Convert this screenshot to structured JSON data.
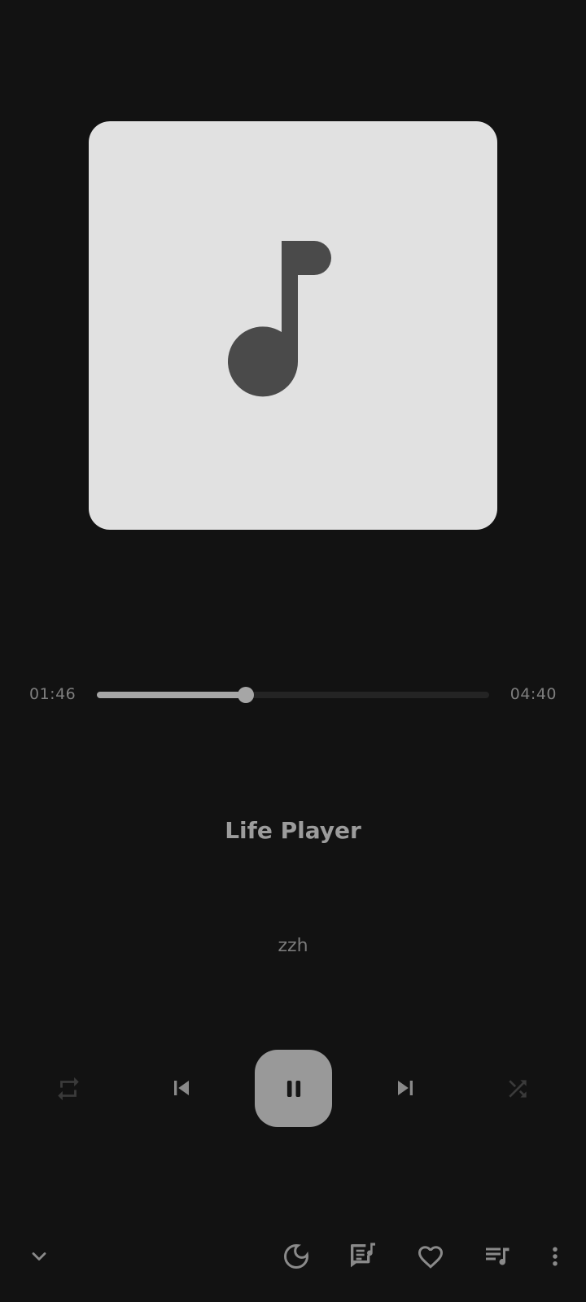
{
  "player": {
    "current_time": "01:46",
    "total_time": "04:40",
    "progress": 0.379,
    "title": "Life Player",
    "artist": "zzh"
  },
  "icons": {
    "album_art": "music-note-icon",
    "repeat": "repeat-icon",
    "previous": "skip-previous-icon",
    "play_pause": "pause-icon",
    "next": "skip-next-icon",
    "shuffle": "shuffle-icon",
    "collapse": "chevron-down-icon",
    "sleep_timer": "moon-icon",
    "lyrics": "lyrics-icon",
    "favorite": "heart-icon",
    "queue": "queue-music-icon",
    "more": "more-vert-icon"
  },
  "colors": {
    "background": "#121212",
    "album_bg": "#e1e1e1",
    "accent": "#999999"
  }
}
